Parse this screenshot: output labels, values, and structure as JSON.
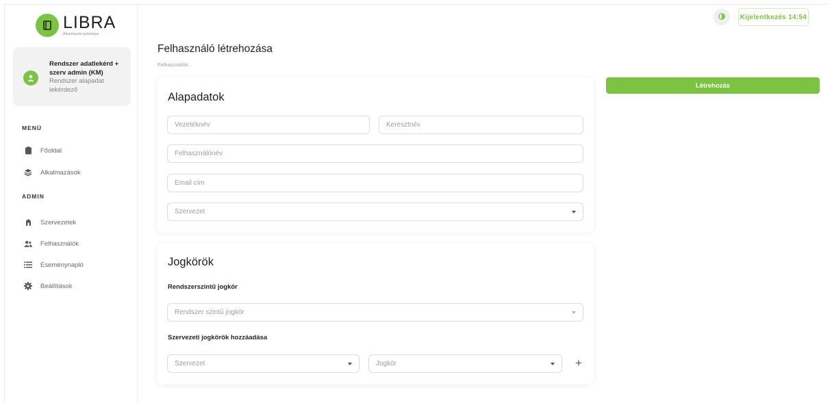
{
  "brand": {
    "name": "LIBRA",
    "subtitle": "Alkalmazás-katalógus",
    "color": "#7cc243"
  },
  "user": {
    "name": "Rendszer adatlekérd + szerv admin (KM)",
    "role": "Rendszer alapadat lekérdező"
  },
  "sidebar": {
    "menu_label": "MENÜ",
    "menu_items": [
      {
        "label": "Főoldal",
        "icon": "clipboard-icon"
      },
      {
        "label": "Alkalmazások",
        "icon": "layers-icon"
      }
    ],
    "admin_label": "ADMIN",
    "admin_items": [
      {
        "label": "Szervezetek",
        "icon": "building-icon"
      },
      {
        "label": "Felhasználók",
        "icon": "users-icon"
      },
      {
        "label": "Eseménynapló",
        "icon": "list-icon"
      },
      {
        "label": "Beállítások",
        "icon": "gear-icon"
      }
    ]
  },
  "header": {
    "theme_toggle_icon": "contrast-icon",
    "logout_label": "Kijelentkezés 14:54"
  },
  "page": {
    "title": "Felhasználó létrehozása",
    "breadcrumb": "Felhasználók",
    "create_label": "Létrehozás"
  },
  "basic": {
    "title": "Alapadatok",
    "lastname_placeholder": "Vezetéknév",
    "firstname_placeholder": "Keresztnév",
    "username_placeholder": "Felhasználónév",
    "email_placeholder": "Email cím",
    "org_placeholder": "Szervezet"
  },
  "roles": {
    "title": "Jogkörök",
    "system_label": "Rendszerszintű jogkör",
    "system_placeholder": "Rendszer szintű jogkör",
    "org_roles_label": "Szervezeti jogkörök hozzáadása",
    "org_placeholder": "Szervezet",
    "role_placeholder": "Jogkör",
    "add_symbol": "+"
  }
}
